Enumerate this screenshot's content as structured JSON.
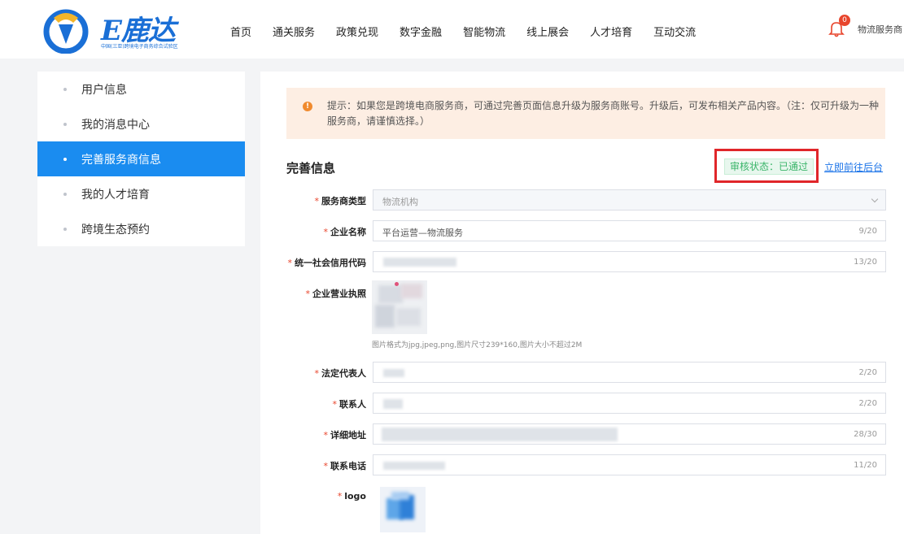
{
  "brand": {
    "logo_text": "E鹿达",
    "logo_subtitle": "中国(三亚)跨境电子商务综合试验区"
  },
  "nav": {
    "items": [
      "首页",
      "通关服务",
      "政策兑现",
      "数字金融",
      "智能物流",
      "线上展会",
      "人才培育",
      "互动交流"
    ]
  },
  "user": {
    "notification_count": "0",
    "name": "物流服务商"
  },
  "sidebar": {
    "items": [
      {
        "label": "用户信息",
        "active": false
      },
      {
        "label": "我的消息中心",
        "active": false
      },
      {
        "label": "完善服务商信息",
        "active": true
      },
      {
        "label": "我的人才培育",
        "active": false
      },
      {
        "label": "跨境生态预约",
        "active": false
      }
    ]
  },
  "tip": {
    "icon": "!",
    "text": "提示：如果您是跨境电商服务商，可通过完善页面信息升级为服务商账号。升级后，可发布相关产品内容。（注：仅可升级为一种服务商，请谨慎选择。）"
  },
  "form": {
    "title": "完善信息",
    "audit_status": "审核状态：已通过",
    "backend_link": "立即前往后台",
    "required_mark": "*",
    "provider_type": {
      "label": "服务商类型",
      "value": "物流机构"
    },
    "company_name": {
      "label": "企业名称",
      "value": "平台运营—物流服务",
      "count": "9/20"
    },
    "credit_code": {
      "label": "统一社会信用代码",
      "count": "13/20"
    },
    "business_license": {
      "label": "企业营业执照",
      "hint": "图片格式为jpg,jpeg,png,图片尺寸239*160,图片大小不超过2M"
    },
    "legal_rep": {
      "label": "法定代表人",
      "count": "2/20"
    },
    "contact": {
      "label": "联系人",
      "count": "2/20"
    },
    "address": {
      "label": "详细地址",
      "count": "28/30"
    },
    "phone": {
      "label": "联系电话",
      "count": "11/20"
    },
    "logo": {
      "label": "logo"
    }
  },
  "colors": {
    "accent": "#1a8cf0",
    "status_green": "#3bb56a",
    "highlight_red": "#e0262a",
    "tip_bg": "#fdeee3"
  }
}
